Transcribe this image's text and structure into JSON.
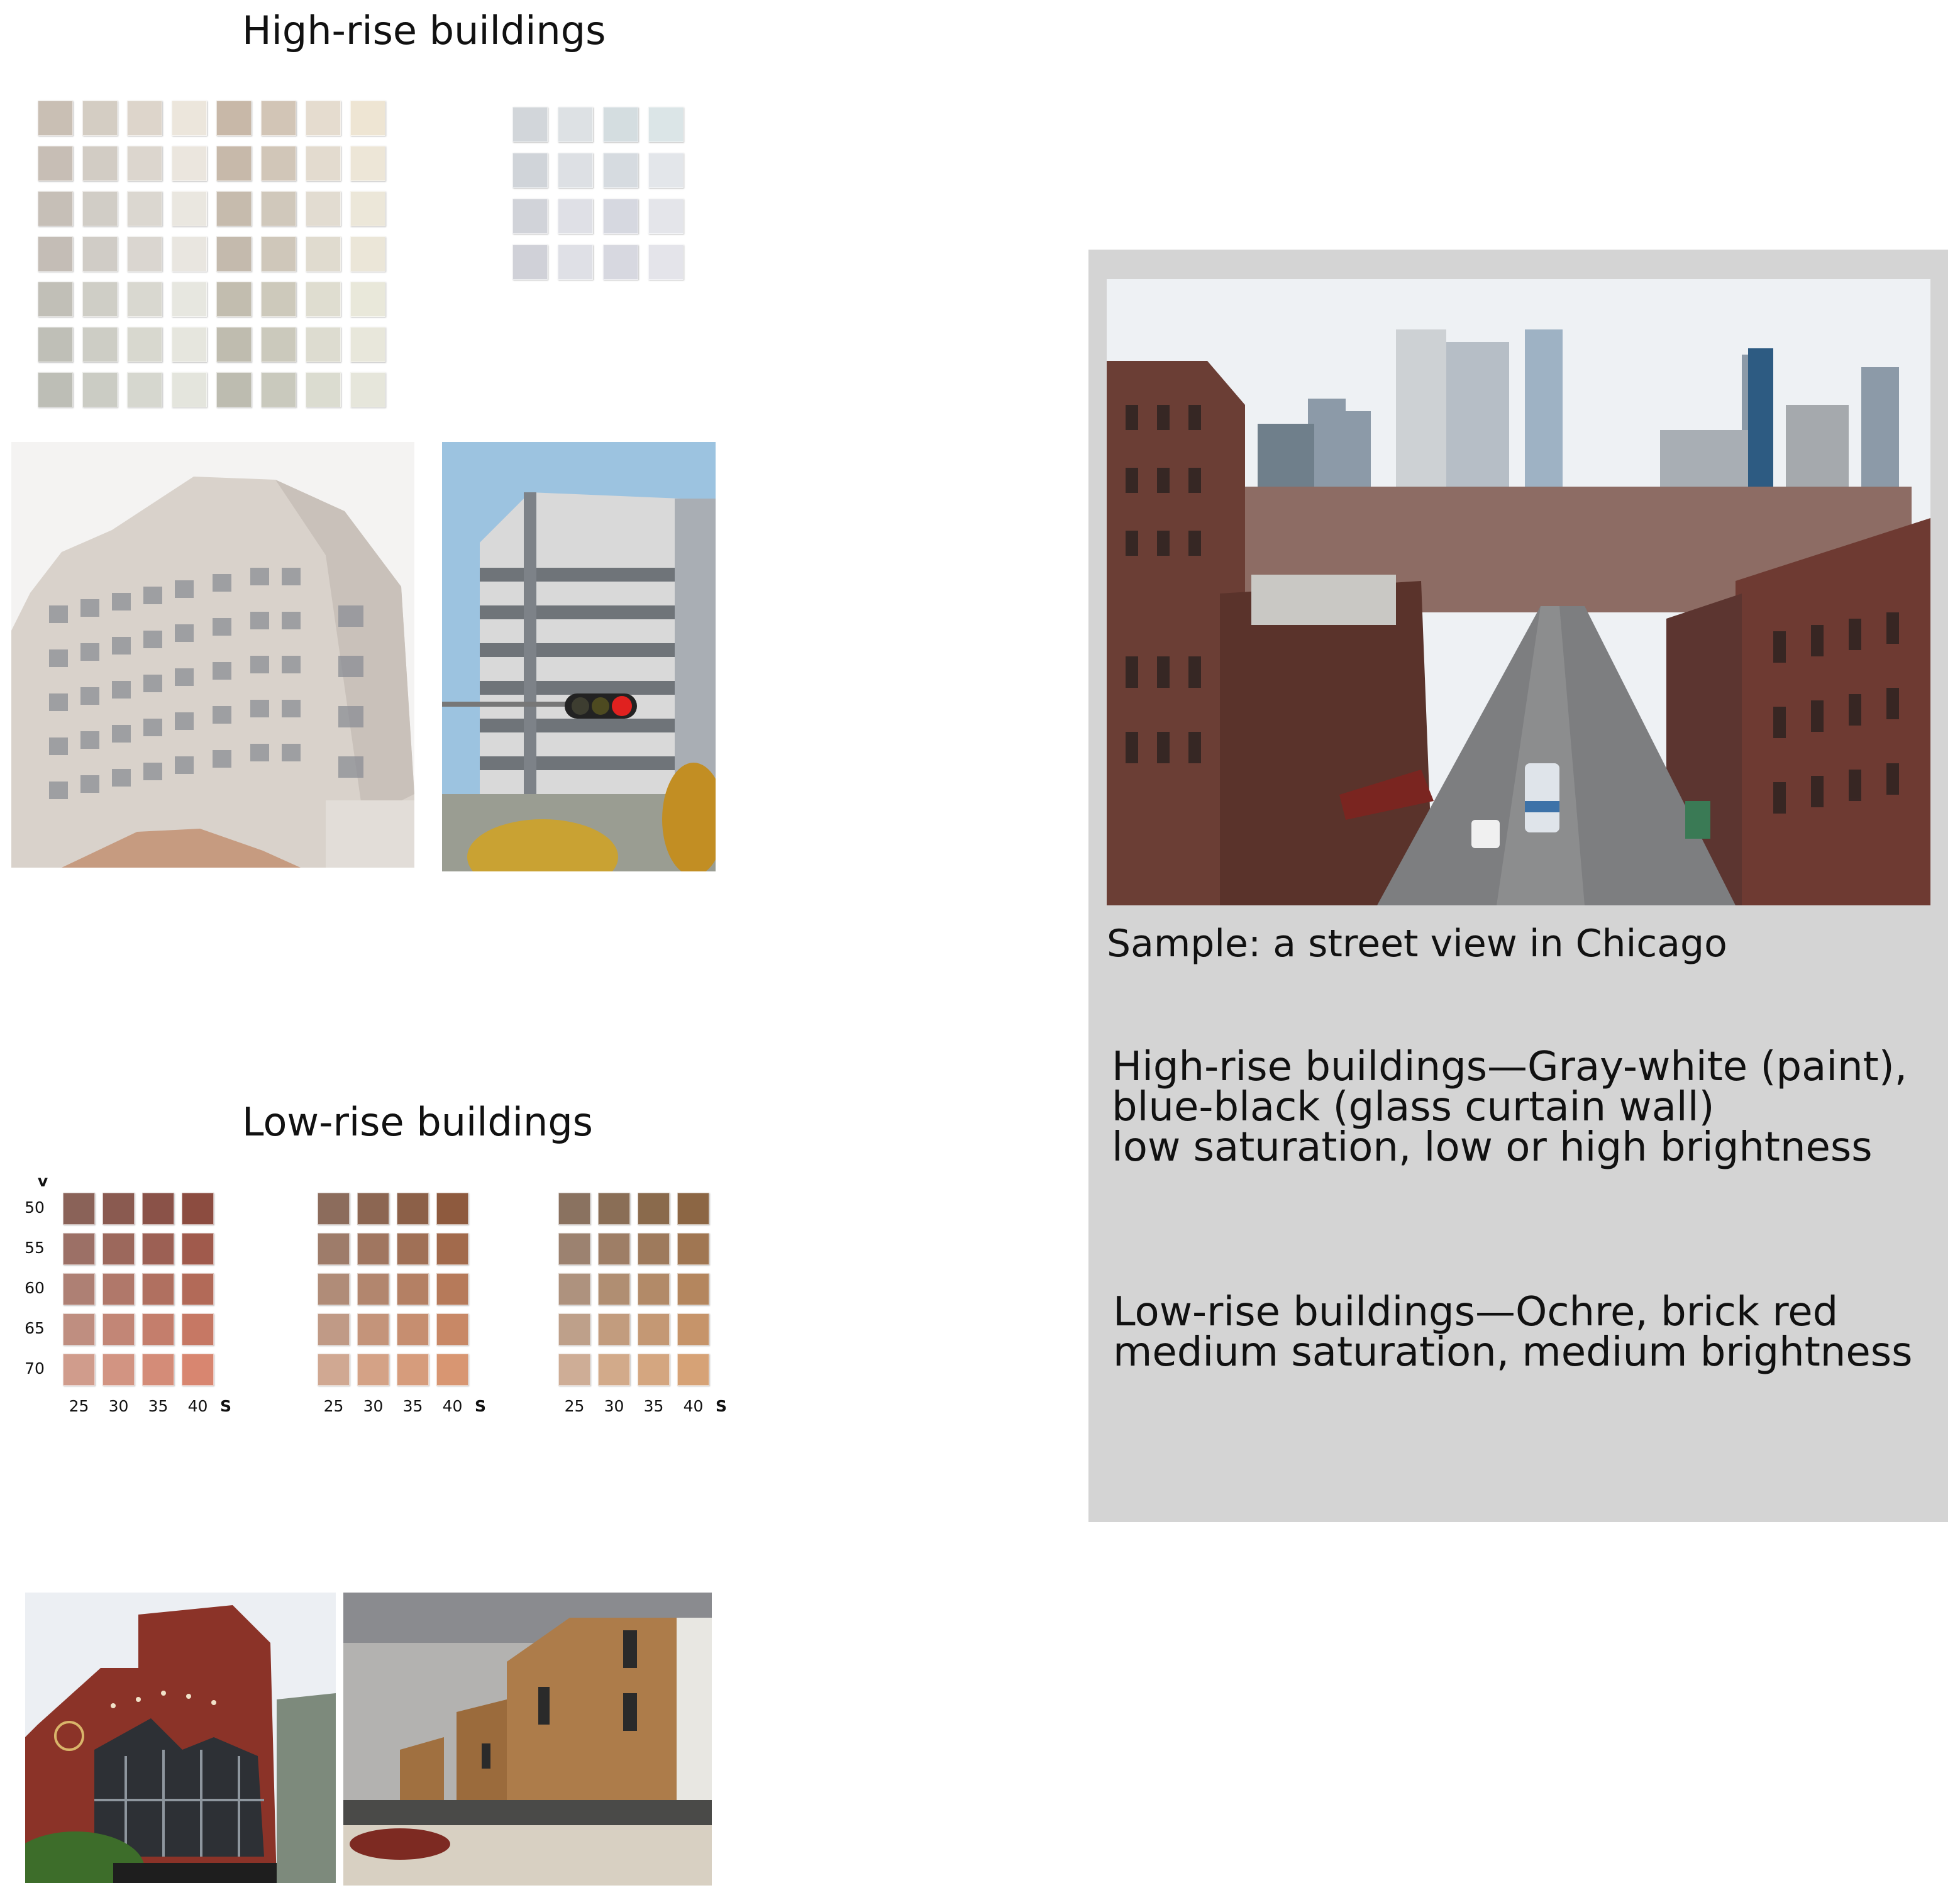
{
  "high_rise": {
    "title": "High-rise buildings",
    "palette_a": {
      "rows": [
        [
          "#c9bfb4",
          "#d4cdc3",
          "#ddd5cb",
          "#ece6dc",
          "#c8b8a8",
          "#d2c5b6",
          "#e5dccf",
          "#eee5d3"
        ],
        [
          "#c7beb5",
          "#d2ccc4",
          "#dcd6ce",
          "#ebe6de",
          "#c7b9aa",
          "#d1c6b8",
          "#e3dbcf",
          "#ede6d7"
        ],
        [
          "#c6bfb7",
          "#d1cdc6",
          "#dbd7d0",
          "#eae7e0",
          "#c6bbad",
          "#d0c8bb",
          "#e2dcd1",
          "#ece7d9"
        ],
        [
          "#c4bdb6",
          "#d0ccc6",
          "#dad6d0",
          "#e9e6e0",
          "#c4baad",
          "#cfc7ba",
          "#e0dbcf",
          "#ebe6d8"
        ],
        [
          "#c1bfb7",
          "#cfcec6",
          "#d9d8d0",
          "#e7e7e0",
          "#c2bdaf",
          "#cdc9bb",
          "#dfddd0",
          "#e9e8da"
        ],
        [
          "#bfbfb7",
          "#cdcdc5",
          "#d8d8cf",
          "#e6e6de",
          "#bfbcaf",
          "#cbc9bc",
          "#dddcd0",
          "#e8e7db"
        ],
        [
          "#bdbeb6",
          "#cbccc4",
          "#d6d7cf",
          "#e4e5dd",
          "#bdbcb0",
          "#c9c9bd",
          "#dbdcd0",
          "#e6e6db"
        ]
      ]
    },
    "palette_b": {
      "rows": [
        [
          "#d2d6da",
          "#dde1e4",
          "#d4dde0",
          "#dbe5e7"
        ],
        [
          "#d0d4d9",
          "#dde0e4",
          "#d6dbe0",
          "#e3e6ea"
        ],
        [
          "#d1d3d9",
          "#dfe0e6",
          "#d6d8e0",
          "#e4e5ea"
        ],
        [
          "#d0d1d8",
          "#dfe0e6",
          "#d7d8e0",
          "#e4e4ea"
        ]
      ]
    }
  },
  "low_rise": {
    "title": "Low-rise buildings",
    "v_axis_title": "v",
    "v_values": [
      "50",
      "55",
      "60",
      "65",
      "70"
    ],
    "s_values": [
      "25",
      "30",
      "35",
      "40"
    ],
    "s_axis_title": "S",
    "palettes": [
      {
        "rows": [
          [
            "#8a6258",
            "#8a5a50",
            "#8a5248",
            "#8c4c40"
          ],
          [
            "#9c7066",
            "#9c685c",
            "#9c6054",
            "#a05a4c"
          ],
          [
            "#ae8074",
            "#b0786a",
            "#b07060",
            "#b26a58"
          ],
          [
            "#bf8e80",
            "#c28676",
            "#c47e6c",
            "#c67864"
          ],
          [
            "#d09c8c",
            "#d29482",
            "#d48c78",
            "#d88670"
          ]
        ]
      },
      {
        "rows": [
          [
            "#8c6c5c",
            "#8c6652",
            "#8c6048",
            "#8e5a3e"
          ],
          [
            "#9e7c6a",
            "#a07660",
            "#a07056",
            "#a26a4c"
          ],
          [
            "#b08c78",
            "#b2866e",
            "#b48064",
            "#b67a5a"
          ],
          [
            "#c09a86",
            "#c4947a",
            "#c68e70",
            "#c88866"
          ],
          [
            "#d0a892",
            "#d4a286",
            "#d69c7c",
            "#d89672"
          ]
        ]
      },
      {
        "rows": [
          [
            "#8a7260",
            "#8a6e56",
            "#8a6a4c",
            "#8c6644"
          ],
          [
            "#9c8270",
            "#9e7e66",
            "#9e7a5c",
            "#a07652"
          ],
          [
            "#ae927e",
            "#b08e72",
            "#b28a68",
            "#b4865e"
          ],
          [
            "#bea08a",
            "#c29c7e",
            "#c49874",
            "#c6946a"
          ],
          [
            "#cead96",
            "#d2aa8a",
            "#d4a680",
            "#d6a276"
          ]
        ]
      }
    ]
  },
  "sample_panel": {
    "caption": "Sample: a street view in Chicago",
    "high_rise_desc": [
      "High-rise buildings—Gray-white (paint),",
      "blue-black (glass curtain wall)",
      "low saturation, low or high brightness"
    ],
    "low_rise_desc": [
      "Low-rise buildings—Ochre, brick red",
      "medium saturation, medium brightness"
    ],
    "background_color": "#d4d4d4"
  }
}
